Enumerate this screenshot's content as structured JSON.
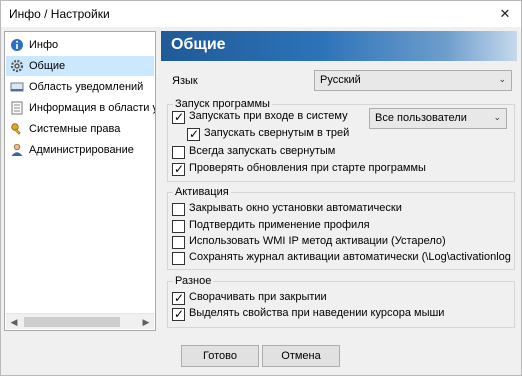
{
  "window": {
    "title": "Инфо / Настройки",
    "close_glyph": "✕"
  },
  "sidebar": {
    "items": [
      {
        "label": "Инфо",
        "icon": "info-icon"
      },
      {
        "label": "Общие",
        "icon": "gear-icon",
        "selected": true
      },
      {
        "label": "Область уведомлений",
        "icon": "notification-area-icon"
      },
      {
        "label": "Информация в области у",
        "icon": "tray-info-icon"
      },
      {
        "label": "Системные права",
        "icon": "key-icon"
      },
      {
        "label": "Администрирование",
        "icon": "admin-user-icon"
      }
    ],
    "scroll_left": "◀",
    "scroll_right": "▶"
  },
  "main": {
    "title": "Общие",
    "language": {
      "label": "Язык",
      "value": "Русский"
    },
    "startup": {
      "title": "Запуск программы",
      "run_at_login": {
        "label": "Запускать при входе в систему",
        "checked": true
      },
      "users_select": {
        "value": "Все пользователи"
      },
      "start_minimized_tray": {
        "label": "Запускать свернутым в трей",
        "checked": true
      },
      "always_minimized": {
        "label": "Всегда запускать свернутым",
        "checked": false
      },
      "check_updates": {
        "label": "Проверять обновления при старте программы",
        "checked": true
      }
    },
    "activation": {
      "title": "Активация",
      "close_setup_window": {
        "label": "Закрывать окно установки автоматически",
        "checked": false
      },
      "confirm_profile": {
        "label": "Подтвердить применение профиля",
        "checked": false
      },
      "use_wmi": {
        "label": "Использовать WMI IP метод активации (Устарело)",
        "checked": false
      },
      "save_log": {
        "label": "Сохранять журнал активации автоматически (\\Log\\activationlog",
        "checked": false
      }
    },
    "misc": {
      "title": "Разное",
      "minimize_on_close": {
        "label": "Сворачивать при закрытии",
        "checked": true
      },
      "highlight_on_hover": {
        "label": "Выделять свойства при наведении курсора мыши",
        "checked": true
      }
    }
  },
  "buttons": {
    "ok": "Готово",
    "cancel": "Отмена"
  },
  "glyphs": {
    "check": "✓",
    "chevron": "⌄"
  },
  "colors": {
    "selection": "#cce8ff",
    "banner": "#2d73b8"
  }
}
